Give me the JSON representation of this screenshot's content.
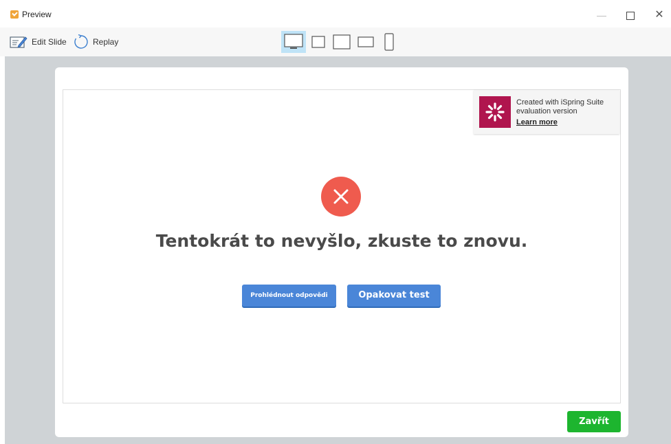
{
  "window": {
    "title": "Preview",
    "controls": {
      "minimize": "—",
      "close": "✕"
    }
  },
  "toolbar": {
    "edit_slide_label": "Edit Slide",
    "replay_label": "Replay",
    "devices": [
      "desktop-icon",
      "tablet-portrait-icon",
      "tablet-landscape-icon",
      "tablet-wide-icon",
      "phone-icon"
    ],
    "active_device": "desktop-icon"
  },
  "badge": {
    "line1": "Created with iSpring Suite",
    "line2": "evaluation version",
    "link": "Learn more",
    "logo_color": "#b0154e"
  },
  "result": {
    "message": "Tentokrát to nevyšlo, zkuste to znovu.",
    "icon": "error-x-icon",
    "icon_color": "#ef5b4e"
  },
  "buttons": {
    "review": "Prohlédnout odpovědi",
    "retry": "Opakovat test",
    "close": "Zavřít"
  },
  "colors": {
    "button_blue": "#4a86d8",
    "button_green": "#1db52f",
    "canvas_bg": "#cfd3d6"
  }
}
